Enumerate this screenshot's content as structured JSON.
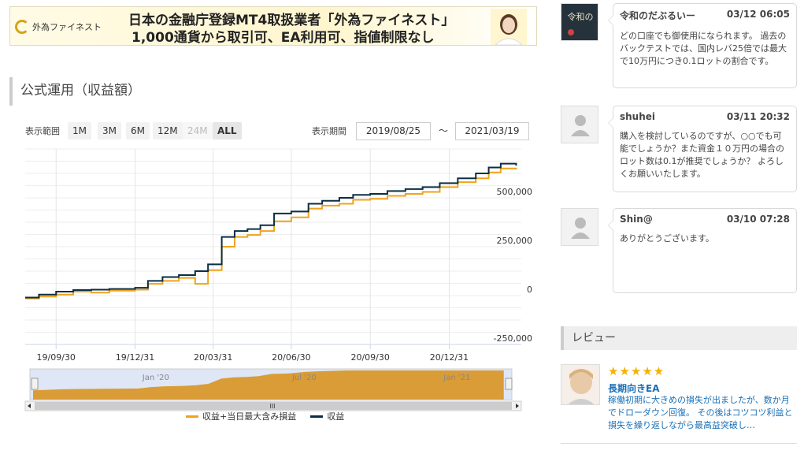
{
  "banner": {
    "logo_text": "外為ファイネスト",
    "line1": "日本の金融庁登録MT4取扱業者「外為ファイネスト」",
    "line2": "1,000通貨から取引可、EA利用可、指値制限なし"
  },
  "section": {
    "title": "公式運用（収益額）"
  },
  "controls": {
    "range_label": "表示範囲",
    "ranges": [
      {
        "label": "1M",
        "state": "normal"
      },
      {
        "label": "3M",
        "state": "normal"
      },
      {
        "label": "6M",
        "state": "normal"
      },
      {
        "label": "12M",
        "state": "normal"
      },
      {
        "label": "24M",
        "state": "disabled"
      },
      {
        "label": "ALL",
        "state": "active"
      }
    ],
    "period_label": "表示期間",
    "from": "2019/08/25",
    "tilde": "～",
    "to": "2021/03/19"
  },
  "chart_data": {
    "type": "line",
    "x_tick_labels": [
      "19/09/30",
      "19/12/31",
      "20/03/31",
      "20/06/30",
      "20/09/30",
      "20/12/31"
    ],
    "y_tick_labels": [
      "500,000",
      "250,000",
      "0",
      "-250,000"
    ],
    "ylim": [
      -250000,
      750000
    ],
    "navigator_labels": [
      "Jan '20",
      "Jul '20",
      "Jan '21"
    ],
    "navigator_handle": "III",
    "colors": {
      "profit": "#0b2e45",
      "drawdown": "#f0a31b",
      "navigator": "#d9982c"
    },
    "series": [
      {
        "name": "収益",
        "x": [
          "2019-08-25",
          "2019-09-10",
          "2019-09-30",
          "2019-10-20",
          "2019-11-10",
          "2019-12-01",
          "2019-12-31",
          "2020-01-15",
          "2020-02-01",
          "2020-02-20",
          "2020-03-10",
          "2020-03-25",
          "2020-04-10",
          "2020-04-25",
          "2020-05-10",
          "2020-05-25",
          "2020-06-10",
          "2020-06-30",
          "2020-07-20",
          "2020-08-05",
          "2020-08-25",
          "2020-09-10",
          "2020-09-30",
          "2020-10-20",
          "2020-11-10",
          "2020-11-30",
          "2020-12-20",
          "2021-01-10",
          "2021-01-31",
          "2021-02-15",
          "2021-03-01",
          "2021-03-19"
        ],
        "values": [
          -10000,
          5000,
          20000,
          28000,
          30000,
          34000,
          40000,
          75000,
          95000,
          105000,
          125000,
          160000,
          300000,
          330000,
          340000,
          360000,
          420000,
          430000,
          470000,
          485000,
          500000,
          515000,
          520000,
          535000,
          545000,
          555000,
          575000,
          600000,
          625000,
          655000,
          675000,
          665000
        ]
      },
      {
        "name": "収益+当日最大含み損益",
        "x": [
          "2019-08-25",
          "2019-09-10",
          "2019-09-30",
          "2019-10-20",
          "2019-11-10",
          "2019-12-01",
          "2019-12-31",
          "2020-01-15",
          "2020-02-01",
          "2020-02-20",
          "2020-03-10",
          "2020-03-25",
          "2020-04-10",
          "2020-04-25",
          "2020-05-10",
          "2020-05-25",
          "2020-06-10",
          "2020-06-30",
          "2020-07-20",
          "2020-08-05",
          "2020-08-25",
          "2020-09-10",
          "2020-09-30",
          "2020-10-20",
          "2020-11-10",
          "2020-11-30",
          "2020-12-20",
          "2021-01-10",
          "2021-01-31",
          "2021-02-15",
          "2021-03-01",
          "2021-03-19"
        ],
        "values": [
          -15000,
          -5000,
          5000,
          20000,
          15000,
          25000,
          30000,
          60000,
          75000,
          90000,
          60000,
          130000,
          250000,
          300000,
          310000,
          330000,
          380000,
          400000,
          445000,
          460000,
          470000,
          490000,
          495000,
          510000,
          520000,
          530000,
          555000,
          580000,
          600000,
          630000,
          650000,
          645000
        ]
      }
    ],
    "legend": [
      {
        "name": "収益+当日最大含み損益",
        "color": "#f0a31b"
      },
      {
        "name": "収益",
        "color": "#0b2e45"
      }
    ]
  },
  "comments": [
    {
      "user": "令和のだぶるいー",
      "time": "03/12 06:05",
      "body": "どの口座でも御使用になられます。 過去のバックテストでは、国内レバ25倍では最大で10万円につき0.1ロットの割合です。",
      "avatar_text": "令和の"
    },
    {
      "user": "shuhei",
      "time": "03/11 20:32",
      "body": "購入を検討しているのですが、○○でも可能でしょうか？また資金１０万円の場合のロット数は0.1が推奨でしょうか？ よろしくお願いいたします。"
    },
    {
      "user": "Shin@",
      "time": "03/10 07:28",
      "body": "ありがとうございます。"
    }
  ],
  "review": {
    "section_title": "レビュー",
    "stars": "★★★★★",
    "title": "長期向きEA",
    "body": "稼働初期に大きめの損失が出ましたが、数か月でドローダウン回復。 その後はコツコツ利益と損失を繰り返しながら最高益突破し…"
  }
}
